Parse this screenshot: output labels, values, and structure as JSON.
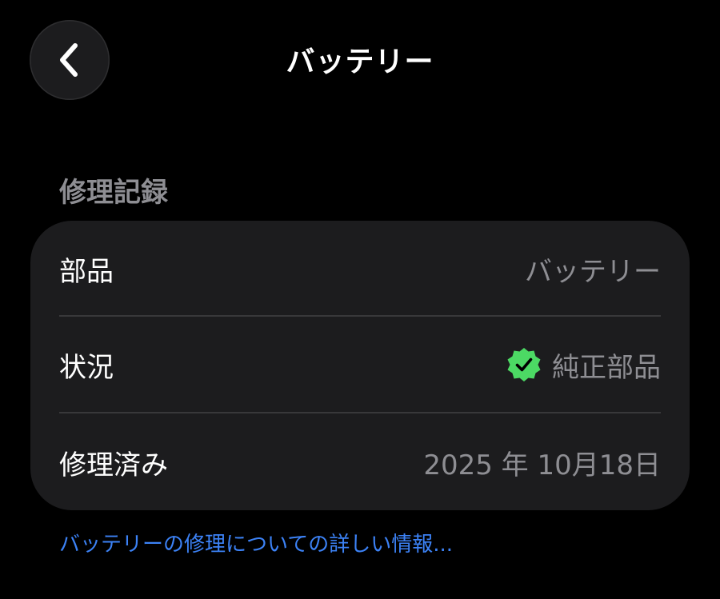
{
  "nav": {
    "title": "バッテリー",
    "back_icon": "chevron-left-icon"
  },
  "section": {
    "header": "修理記録"
  },
  "rows": [
    {
      "label": "部品",
      "value": "バッテリー"
    },
    {
      "label": "状況",
      "value": "純正部品",
      "icon": "verified-badge-icon",
      "icon_color": "#4cd964"
    },
    {
      "label": "修理済み",
      "value": "2025 年 10月18日"
    }
  ],
  "footer": {
    "link_text": "バッテリーの修理についての詳しい情報..."
  },
  "colors": {
    "background": "#000000",
    "card": "#1c1c1e",
    "secondary_text": "#8e8e93",
    "link": "#3c82f6",
    "badge": "#4cd964"
  }
}
